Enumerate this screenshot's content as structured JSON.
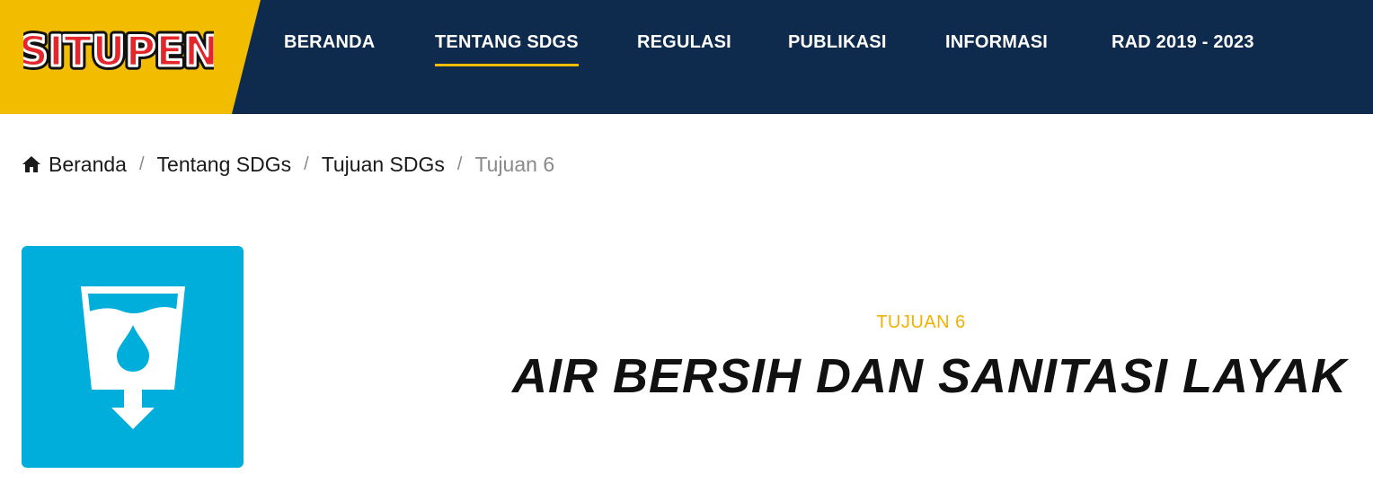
{
  "brand": {
    "logo_text": "SITUPEN",
    "accent_color": "#f2bc00",
    "nav_bg": "#0e2a4d"
  },
  "nav": {
    "items": [
      {
        "label": "BERANDA"
      },
      {
        "label": "TENTANG SDGS"
      },
      {
        "label": "REGULASI"
      },
      {
        "label": "PUBLIKASI"
      },
      {
        "label": "INFORMASI"
      },
      {
        "label": "RAD 2019 - 2023"
      }
    ],
    "active_index": 1
  },
  "breadcrumb": {
    "icon": "home-icon",
    "items": [
      "Beranda",
      "Tentang SDGs",
      "Tujuan SDGs",
      "Tujuan 6"
    ]
  },
  "goal": {
    "icon": "water-glass-icon",
    "icon_bg": "#00aedb",
    "label": "TUJUAN 6",
    "title": "AIR BERSIH DAN SANITASI LAYAK"
  }
}
